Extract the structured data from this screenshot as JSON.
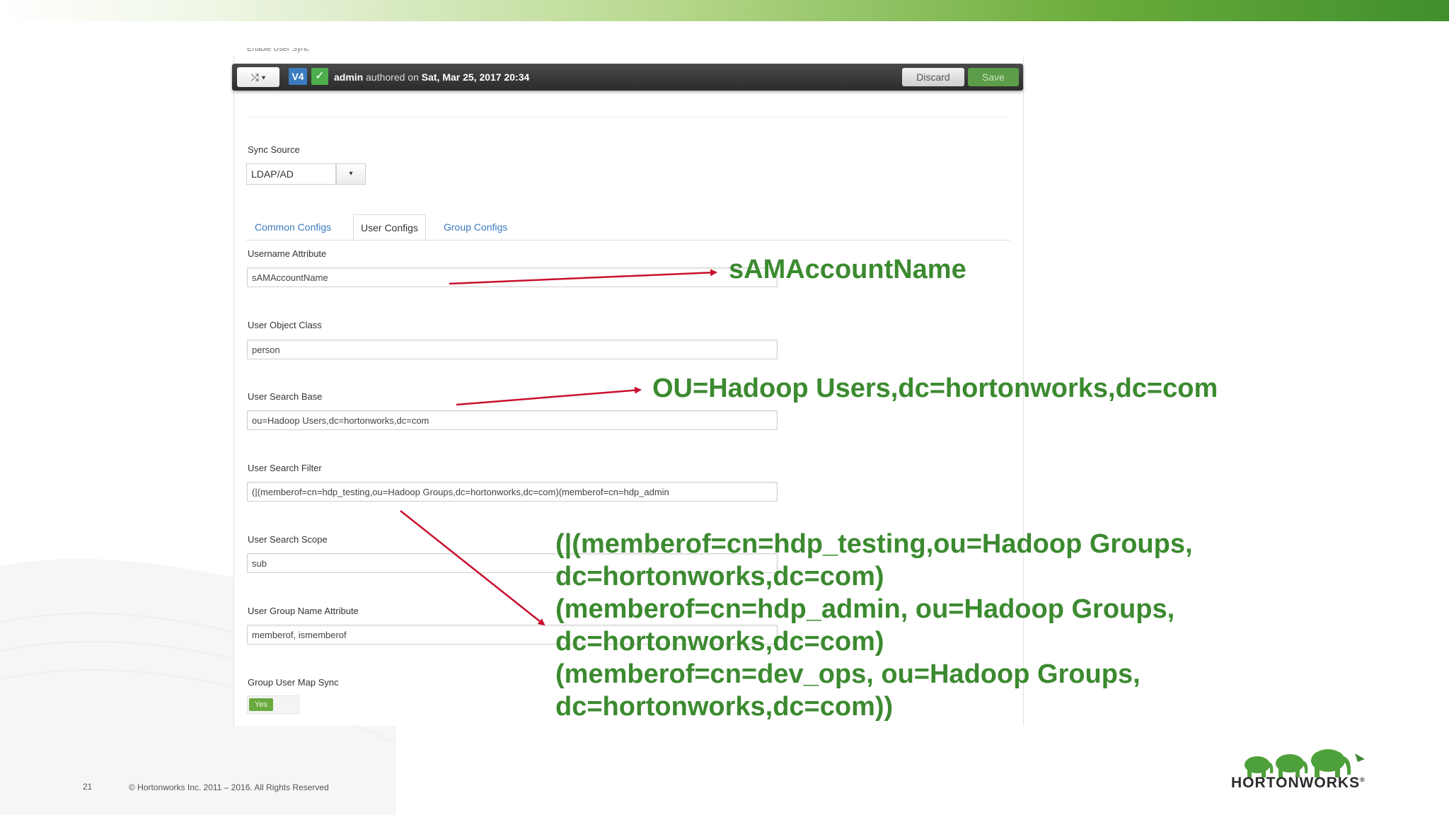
{
  "app": {
    "hidden_label": "Enable User Sync"
  },
  "toolbar": {
    "shuffle_label": "⤮ ▾",
    "version": "V4",
    "check_icon": "✓",
    "author": "admin",
    "authored_on": "authored on",
    "date": "Sat, Mar 25, 2017 20:34",
    "discard_label": "Discard",
    "save_label": "Save"
  },
  "sync_source": {
    "label": "Sync Source",
    "value": "LDAP/AD",
    "caret": "▾"
  },
  "tabs": [
    {
      "label": "Common Configs",
      "active": false
    },
    {
      "label": "User Configs",
      "active": true
    },
    {
      "label": "Group Configs",
      "active": false
    }
  ],
  "fields": {
    "username_attribute": {
      "label": "Username Attribute",
      "value": "sAMAccountName"
    },
    "user_object_class": {
      "label": "User Object Class",
      "value": "person"
    },
    "user_search_base": {
      "label": "User Search Base",
      "value": "ou=Hadoop Users,dc=hortonworks,dc=com"
    },
    "user_search_filter": {
      "label": "User Search Filter",
      "value": "(|(memberof=cn=hdp_testing,ou=Hadoop Groups,dc=hortonworks,dc=com)(memberof=cn=hdp_admin"
    },
    "user_search_scope": {
      "label": "User Search Scope",
      "value": "sub"
    },
    "user_group_name_attribute": {
      "label": "User Group Name Attribute",
      "value": "memberof, ismemberof"
    },
    "group_user_map_sync": {
      "label": "Group User Map Sync",
      "value": "Yes"
    }
  },
  "annotations": {
    "username": "sAMAccountName",
    "search_base": "OU=Hadoop Users,dc=hortonworks,dc=com",
    "search_filter_lines": [
      "(|(memberof=cn=hdp_testing,ou=Hadoop Groups,",
      "dc=hortonworks,dc=com)",
      "(memberof=cn=hdp_admin, ou=Hadoop Groups,",
      "dc=hortonworks,dc=com)",
      "(memberof=cn=dev_ops, ou=Hadoop Groups,",
      "dc=hortonworks,dc=com))"
    ],
    "arrow_color": "#c8102e",
    "text_color": "#3c8a30"
  },
  "footer": {
    "slide_number": "21",
    "copyright": "© Hortonworks Inc. 2011 – 2016. All Rights Reserved",
    "logo_text": "HORTONWORKS",
    "logo_mark": "®"
  }
}
